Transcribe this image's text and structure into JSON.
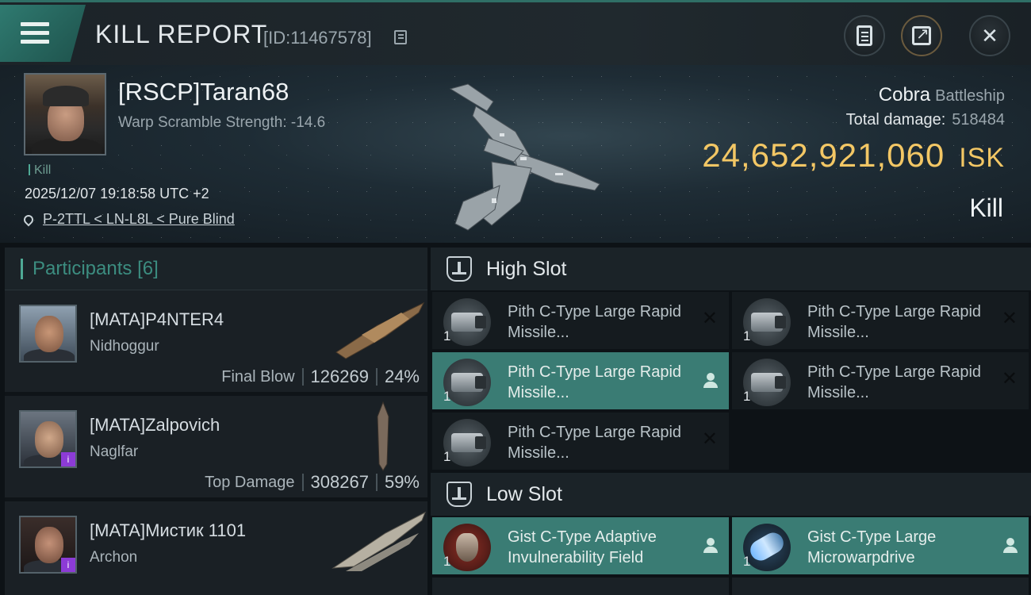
{
  "header": {
    "title": "KILL REPORT",
    "kill_id": "[ID:11467578]"
  },
  "victim": {
    "name": "[RSCP]Taran68",
    "warp_scramble": "Warp Scramble Strength: -14.6",
    "kill_tag": "Kill",
    "datetime": "2025/12/07 19:18:58 UTC +2",
    "location": "P-2TTL < LN-L8L < Pure Blind",
    "ship_name": "Cobra",
    "ship_class": "Battleship",
    "total_damage_label": "Total damage:",
    "total_damage": "518484",
    "isk_value": "24,652,921,060",
    "isk_unit": "ISK",
    "result": "Kill"
  },
  "participants": {
    "label": "Participants",
    "count": "[6]",
    "items": [
      {
        "name": "[MATA]P4NTER4",
        "ship": "Nidhoggur",
        "role": "Final Blow",
        "damage": "126269",
        "percent": "24%"
      },
      {
        "name": "[MATA]Zalpovich",
        "ship": "Naglfar",
        "role": "Top Damage",
        "damage": "308267",
        "percent": "59%"
      },
      {
        "name": "[MATA]Мистик 1101",
        "ship": "Archon"
      }
    ]
  },
  "slots": {
    "high": {
      "label": "High Slot",
      "modules": [
        {
          "name": "Pith C-Type Large Rapid Missile...",
          "qty": "1"
        },
        {
          "name": "Pith C-Type Large Rapid Missile...",
          "qty": "1"
        },
        {
          "name": "Pith C-Type Large Rapid Missile...",
          "qty": "1"
        },
        {
          "name": "Pith C-Type Large Rapid Missile...",
          "qty": "1"
        },
        {
          "name": "Pith C-Type Large Rapid Missile...",
          "qty": "1"
        }
      ]
    },
    "low": {
      "label": "Low Slot",
      "modules": [
        {
          "name": "Gist C-Type Adaptive Invulnerability Field",
          "qty": "1"
        },
        {
          "name": "Gist C-Type Large Microwarpdrive",
          "qty": "1"
        }
      ]
    }
  },
  "colors": {
    "accent": "#3a7c74",
    "isk": "#f3c765",
    "participants_label": "#3c8d80"
  }
}
